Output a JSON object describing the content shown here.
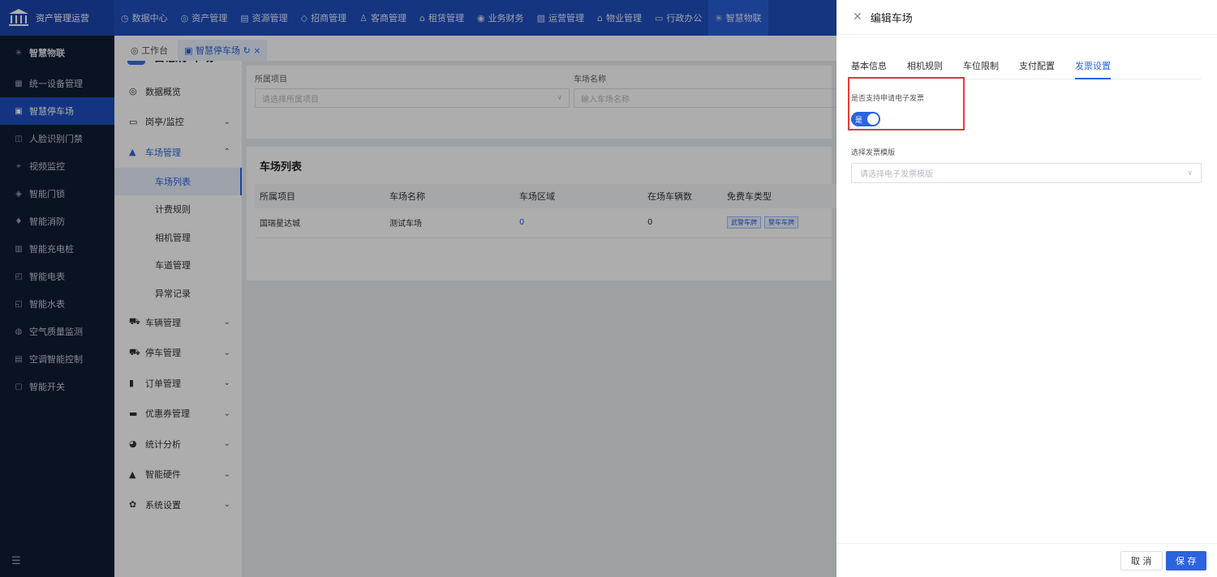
{
  "brand": {
    "title": "资产管理运营"
  },
  "topnav": [
    {
      "icon": "◷",
      "label": "数据中心"
    },
    {
      "icon": "◎",
      "label": "资产管理"
    },
    {
      "icon": "▤",
      "label": "资源管理"
    },
    {
      "icon": "◇",
      "label": "招商管理"
    },
    {
      "icon": "♙",
      "label": "客商管理"
    },
    {
      "icon": "⌂",
      "label": "租赁管理"
    },
    {
      "icon": "◉",
      "label": "业务财务"
    },
    {
      "icon": "▧",
      "label": "运营管理"
    },
    {
      "icon": "⌂",
      "label": "物业管理"
    },
    {
      "icon": "▭",
      "label": "行政办公"
    },
    {
      "icon": "✳",
      "label": "智慧物联"
    }
  ],
  "sidebar": {
    "header": {
      "icon": "✳",
      "label": "智慧物联"
    },
    "items": [
      {
        "icon": "▦",
        "label": "统一设备管理"
      },
      {
        "icon": "▣",
        "label": "智慧停车场"
      },
      {
        "icon": "◫",
        "label": "人脸识别门禁"
      },
      {
        "icon": "⌖",
        "label": "视频监控"
      },
      {
        "icon": "◈",
        "label": "智能门锁"
      },
      {
        "icon": "♦",
        "label": "智能消防"
      },
      {
        "icon": "▥",
        "label": "智能充电桩"
      },
      {
        "icon": "◰",
        "label": "智能电表"
      },
      {
        "icon": "◱",
        "label": "智能水表"
      },
      {
        "icon": "◍",
        "label": "空气质量监测"
      },
      {
        "icon": "▤",
        "label": "空调智能控制"
      },
      {
        "icon": "▢",
        "label": "智能开关"
      }
    ],
    "collapse_icon": "☰"
  },
  "submenu": {
    "title": "智慧停车场",
    "badge": "P",
    "overview": {
      "icon": "◎",
      "label": "数据概览"
    },
    "booth": {
      "icon": "▭",
      "label": "岗亭/监控"
    },
    "parking_mgmt": {
      "icon": "▲",
      "label": "车场管理"
    },
    "children": [
      "车场列表",
      "计费规则",
      "相机管理",
      "车道管理",
      "异常记录"
    ],
    "after": [
      {
        "icon": "⛟",
        "label": "车辆管理"
      },
      {
        "icon": "⛟",
        "label": "停车管理"
      },
      {
        "icon": "▮",
        "label": "订单管理"
      },
      {
        "icon": "▬",
        "label": "优惠券管理"
      },
      {
        "icon": "◕",
        "label": "统计分析"
      },
      {
        "icon": "▲",
        "label": "智能硬件"
      },
      {
        "icon": "✿",
        "label": "系统设置"
      }
    ]
  },
  "tabs": [
    {
      "icon": "◎",
      "label": "工作台"
    },
    {
      "icon": "▣",
      "label": "智慧停车场",
      "refresh": "↻",
      "close": "×"
    }
  ],
  "filter": {
    "project_label": "所属项目",
    "project_placeholder": "请选择所属项目",
    "name_label": "车场名称",
    "name_placeholder": "输入车场名称"
  },
  "table": {
    "title": "车场列表",
    "columns": [
      "所属项目",
      "车场名称",
      "车场区域",
      "在场车辆数",
      "免费车类型"
    ],
    "rows": [
      {
        "project": "国瑞星达城",
        "name": "测试车场",
        "area": "0",
        "count": "0",
        "tags": [
          "武警车牌",
          "警车车牌"
        ]
      }
    ]
  },
  "drawer": {
    "title": "编辑车场",
    "tabs": [
      "基本信息",
      "相机规则",
      "车位限制",
      "支付配置",
      "发票设置"
    ],
    "active_tab": 4,
    "invoice_label": "是否支持申请电子发票",
    "switch_text": "是",
    "switch_on": true,
    "template_label": "选择发票模版",
    "template_placeholder": "请选择电子发票模版",
    "cancel": "取 消",
    "save": "保 存"
  },
  "colors": {
    "primary": "#2b63e0",
    "topbar": "#1f4fbf",
    "sidebar": "#0f1c33",
    "highlight": "#e23b3b"
  }
}
